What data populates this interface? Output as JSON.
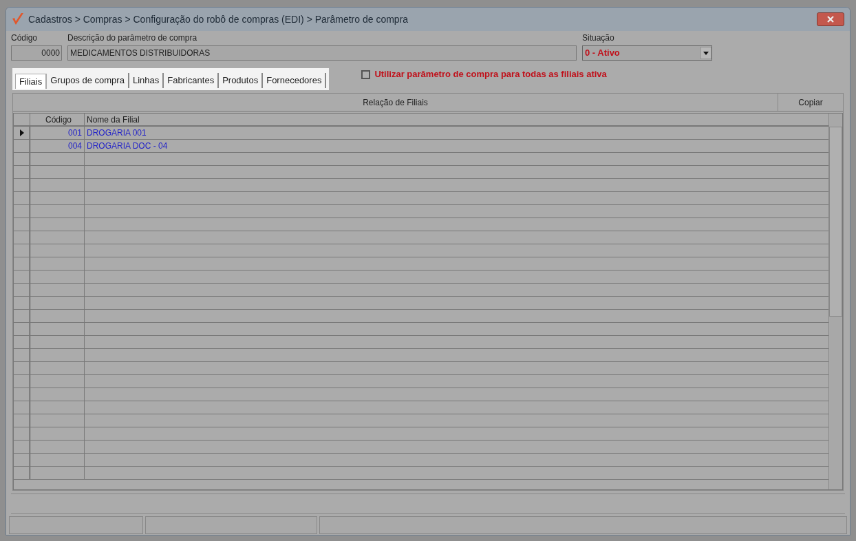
{
  "window": {
    "title": "Cadastros > Compras > Configuração do robô de compras (EDI) > Parâmetro de compra"
  },
  "fields": {
    "codigo_label": "Código",
    "codigo": "0000",
    "descricao_label": "Descrição do parâmetro de compra",
    "descricao": "MEDICAMENTOS DISTRIBUIDORAS",
    "situacao_label": "Situação",
    "situacao": "0 - Ativo"
  },
  "tabs": [
    {
      "label": "Filiais",
      "selected": true
    },
    {
      "label": "Grupos de compra",
      "selected": false
    },
    {
      "label": "Linhas",
      "selected": false
    },
    {
      "label": "Fabricantes",
      "selected": false
    },
    {
      "label": "Produtos",
      "selected": false
    },
    {
      "label": "Fornecedores",
      "selected": false
    }
  ],
  "all_branches": {
    "label": "Utilizar parâmetro de compra para todas as filiais ativa",
    "checked": false
  },
  "grid": {
    "title": "Relação de Filiais",
    "copy_button": "Copiar",
    "columns": [
      "Código",
      "Nome da Filial"
    ],
    "rows": [
      {
        "codigo": "001",
        "nome": "DROGARIA 001",
        "selected": true
      },
      {
        "codigo": "004",
        "nome": "DROGARIA DOC - 04",
        "selected": false
      }
    ]
  }
}
